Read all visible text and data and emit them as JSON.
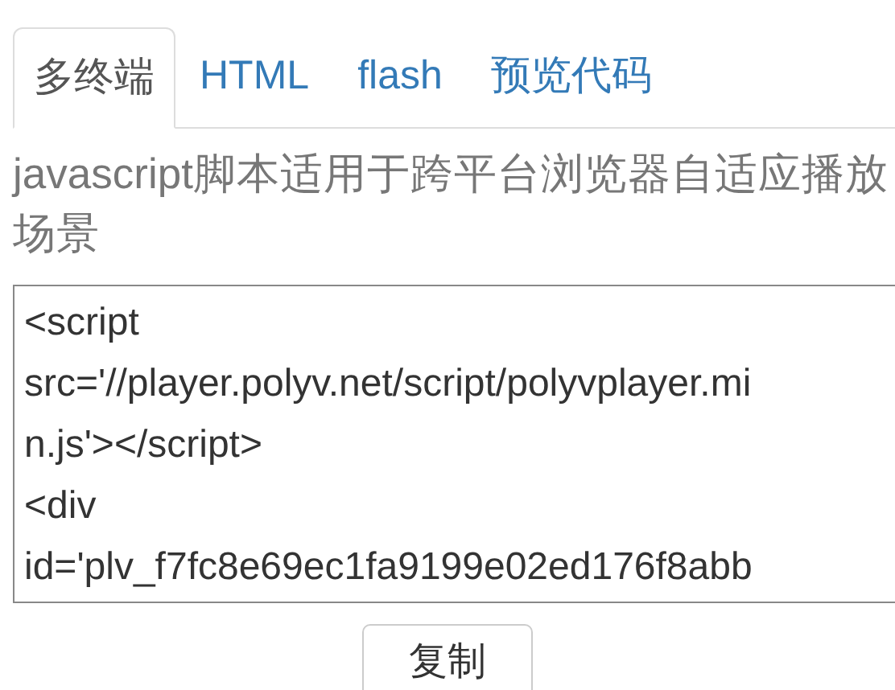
{
  "tabs": [
    {
      "label": "多终端",
      "selected": true
    },
    {
      "label": "HTML",
      "selected": false
    },
    {
      "label": "flash",
      "selected": false
    },
    {
      "label": "预览代码",
      "selected": false
    }
  ],
  "description": "javascript脚本适用于跨平台浏览器自适应播放场景",
  "code_lines": [
    "<script",
    "src='//player.polyv.net/script/polyvplayer.mi",
    "n.js'></script>",
    "<div",
    "id='plv_f7fc8e69ec1fa9199e02ed176f8abb"
  ],
  "copy_button": "复制"
}
